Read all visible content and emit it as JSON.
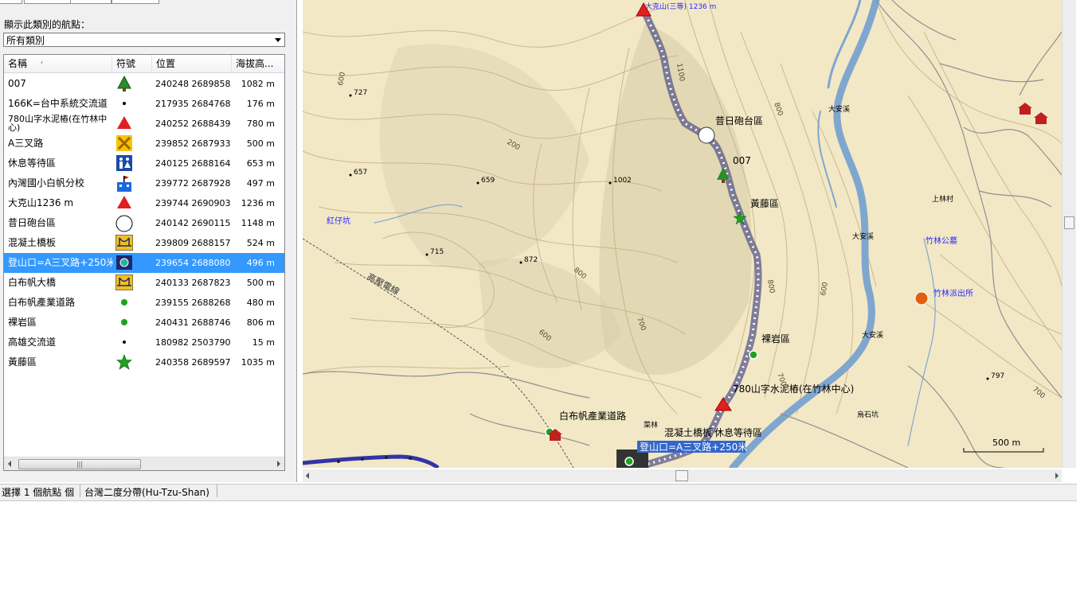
{
  "category_label": "顯示此類別的航點：",
  "category_value": "所有類別",
  "columns": {
    "name": "名稱",
    "symbol": "符號",
    "position": "位置",
    "altitude": "海拔高..."
  },
  "waypoints": [
    {
      "name": "007",
      "symbol": "tree-icon",
      "position": "240248 2689858",
      "altitude": "1082 m"
    },
    {
      "name": "166K=台中系統交流道",
      "symbol": "dot-icon",
      "position": "217935 2684768",
      "altitude": "176 m"
    },
    {
      "name": "780山字水泥樁(在竹林中心)",
      "symbol": "red-triangle-icon",
      "position": "240252 2688439",
      "altitude": "780 m"
    },
    {
      "name": "A三叉路",
      "symbol": "crossroads-icon",
      "position": "239852 2687933",
      "altitude": "500 m"
    },
    {
      "name": "休息等待區",
      "symbol": "restroom-icon",
      "position": "240125 2688164",
      "altitude": "653 m"
    },
    {
      "name": "內灣國小白帆分校",
      "symbol": "school-icon",
      "position": "239772 2687928",
      "altitude": "497 m"
    },
    {
      "name": "大克山1236 m",
      "symbol": "red-triangle-icon",
      "position": "239744 2690903",
      "altitude": "1236 m"
    },
    {
      "name": "昔日砲台區",
      "symbol": "white-circle-icon",
      "position": "240142 2690115",
      "altitude": "1148 m"
    },
    {
      "name": "混凝土橋板",
      "symbol": "bridge-icon",
      "position": "239809 2688157",
      "altitude": "524 m"
    },
    {
      "name": "登山口=A三叉路+250米",
      "symbol": "trailhead-icon",
      "position": "239654 2688080",
      "altitude": "496 m"
    },
    {
      "name": "白布帆大橋",
      "symbol": "bridge-icon",
      "position": "240133 2687823",
      "altitude": "500 m"
    },
    {
      "name": "白布帆產業道路",
      "symbol": "green-dot-icon",
      "position": "239155 2688268",
      "altitude": "480 m"
    },
    {
      "name": "裸岩區",
      "symbol": "green-dot-icon",
      "position": "240431 2688746",
      "altitude": "806 m"
    },
    {
      "name": "高雄交流道",
      "symbol": "dot-icon",
      "position": "180982 2503790",
      "altitude": "15 m"
    },
    {
      "name": "黃藤區",
      "symbol": "green-star-icon",
      "position": "240358 2689597",
      "altitude": "1035 m"
    }
  ],
  "selected_row": 9,
  "map": {
    "peak_label": "大克山(三等) 1236 m",
    "labels": {
      "paotai": "昔日砲台區",
      "w007": "007",
      "huangteng": "黃藤區",
      "luoyan": "裸岩區",
      "sanzi": "780山字水泥樁(在竹林中心)",
      "xiuxi": "休息等待區",
      "hunning": "混凝土橋板",
      "baibufan_road": "白布帆產業道路",
      "trailhead": "登山口=A三叉路+250米",
      "hongzikeng": "紅仔坑",
      "gaoya": "高壓電線",
      "daanxi1": "大安溪",
      "daanxi2": "大安溪",
      "daanxi3": "大安溪",
      "zhulin_school": "竹林公墓",
      "zhulin_police": "竹林派出所",
      "wushi": "烏石坑",
      "shanglin": "上林村",
      "caimin": "菜林",
      "scale": "500 m"
    },
    "spots": [
      "727",
      "657",
      "659",
      "1002",
      "715",
      "872",
      "797"
    ],
    "contours": [
      "1100",
      "800",
      "800",
      "600",
      "600",
      "700",
      "800",
      "700",
      "600",
      "200",
      "700"
    ]
  },
  "status": {
    "selection": "選擇 1 個航點 個",
    "datum": "台灣二度分帶(Hu-Tzu-Shan)"
  }
}
